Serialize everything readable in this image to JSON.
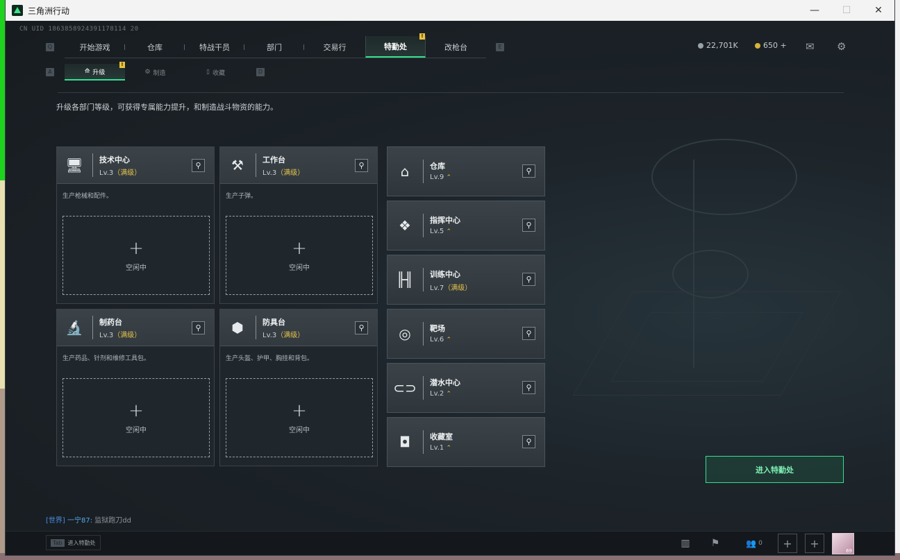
{
  "window": {
    "title": "三角洲行动"
  },
  "header": {
    "uid": "CN UID 1863858924391178114 20",
    "nav_left_key": "Q",
    "nav_right_key": "E",
    "tabs": [
      {
        "label": "开始游戏"
      },
      {
        "label": "仓库"
      },
      {
        "label": "特战干员"
      },
      {
        "label": "部门"
      },
      {
        "label": "交易行"
      },
      {
        "label": "特勤处",
        "active": true,
        "badge": "!"
      },
      {
        "label": "改枪台"
      }
    ],
    "currency1": "22,701K",
    "currency2": "650 +",
    "mail_icon": "mail-icon",
    "settings_icon": "gear-icon"
  },
  "subnav": {
    "left_key": "A",
    "right_key": "D",
    "tabs": [
      {
        "label": "升级",
        "active": true,
        "badge": "!"
      },
      {
        "label": "制造"
      },
      {
        "label": "收藏"
      }
    ]
  },
  "description": "升级各部门等级，可获得专属能力提升，和制造战斗物资的能力。",
  "production_cards": [
    {
      "name": "技术中心",
      "level": "Lv.3",
      "maxed": "（满级）",
      "desc": "生产枪械和配件。",
      "slot_text": "空闲中",
      "icon": "monitor-icon"
    },
    {
      "name": "工作台",
      "level": "Lv.3",
      "maxed": "（满级）",
      "desc": "生产子弹。",
      "slot_text": "空闲中",
      "icon": "tools-icon"
    },
    {
      "name": "制药台",
      "level": "Lv.3",
      "maxed": "（满级）",
      "desc": "生产药品、针剂和维修工具包。",
      "slot_text": "空闲中",
      "icon": "microscope-icon"
    },
    {
      "name": "防具台",
      "level": "Lv.3",
      "maxed": "（满级）",
      "desc": "生产头盔、护甲、胸挂和背包。",
      "slot_text": "空闲中",
      "icon": "armor-icon"
    }
  ],
  "facilities": [
    {
      "name": "仓库",
      "level": "Lv.9",
      "extra": "",
      "icon": "warehouse-icon"
    },
    {
      "name": "指挥中心",
      "level": "Lv.5",
      "extra": "",
      "icon": "command-icon"
    },
    {
      "name": "训练中心",
      "level": "Lv.7",
      "extra": "（满级）",
      "icon": "dumbbell-icon"
    },
    {
      "name": "靶场",
      "level": "Lv.6",
      "extra": "",
      "icon": "target-icon"
    },
    {
      "name": "潜水中心",
      "level": "Lv.2",
      "extra": "",
      "icon": "goggles-icon"
    },
    {
      "name": "收藏室",
      "level": "Lv.1",
      "extra": "",
      "icon": "collection-icon"
    }
  ],
  "enter_button": "进入特勤处",
  "chat": {
    "channel": "[世界]",
    "user": "一宁87:",
    "message": "监狱跑刀dd"
  },
  "bottom": {
    "tab_key": "Tab",
    "tab_label": "进入特勤处",
    "friends_count": "0",
    "avatar_level": "69"
  }
}
